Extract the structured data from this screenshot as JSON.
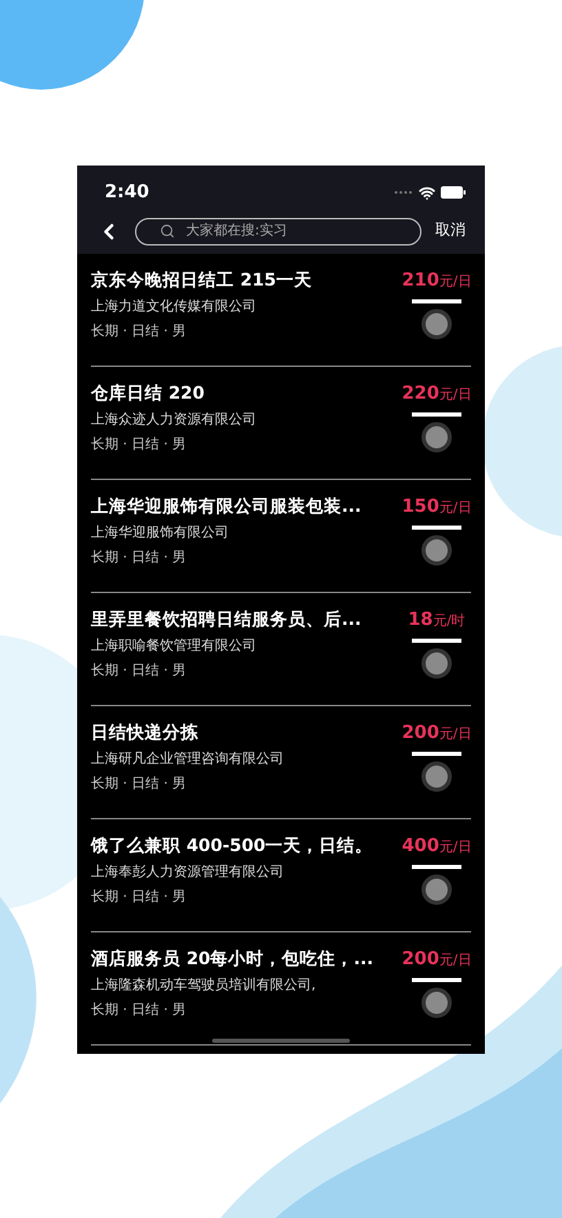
{
  "status_bar": {
    "time": "2:40"
  },
  "search": {
    "placeholder": "大家都在搜:实习",
    "cancel": "取消"
  },
  "jobs": [
    {
      "title": "京东今晚招日结工 215一天",
      "company": "上海力道文化传媒有限公司",
      "tags": "长期 · 日结 · 男",
      "price": "210",
      "unit": "元/日"
    },
    {
      "title": "仓库日结 220",
      "company": "上海众迹人力资源有限公司",
      "tags": "长期 · 日结 · 男",
      "price": "220",
      "unit": "元/日"
    },
    {
      "title": "上海华迎服饰有限公司服装包装...",
      "company": "上海华迎服饰有限公司",
      "tags": "长期 · 日结 · 男",
      "price": "150",
      "unit": "元/日"
    },
    {
      "title": "里弄里餐饮招聘日结服务员、后...",
      "company": "上海职喻餐饮管理有限公司",
      "tags": "长期 · 日结 · 男",
      "price": "18",
      "unit": "元/时"
    },
    {
      "title": "日结快递分拣",
      "company": "上海研凡企业管理咨询有限公司",
      "tags": "长期 · 日结 · 男",
      "price": "200",
      "unit": "元/日"
    },
    {
      "title": "饿了么兼职 400-500一天，日结。",
      "company": "上海奉彭人力资源管理有限公司",
      "tags": "长期 · 日结 · 男",
      "price": "400",
      "unit": "元/日"
    },
    {
      "title": "酒店服务员 20每小时，包吃住，...",
      "company": "上海隆森机动车驾驶员培训有限公司,",
      "tags": "长期 · 日结 · 男",
      "price": "200",
      "unit": "元/日"
    }
  ]
}
